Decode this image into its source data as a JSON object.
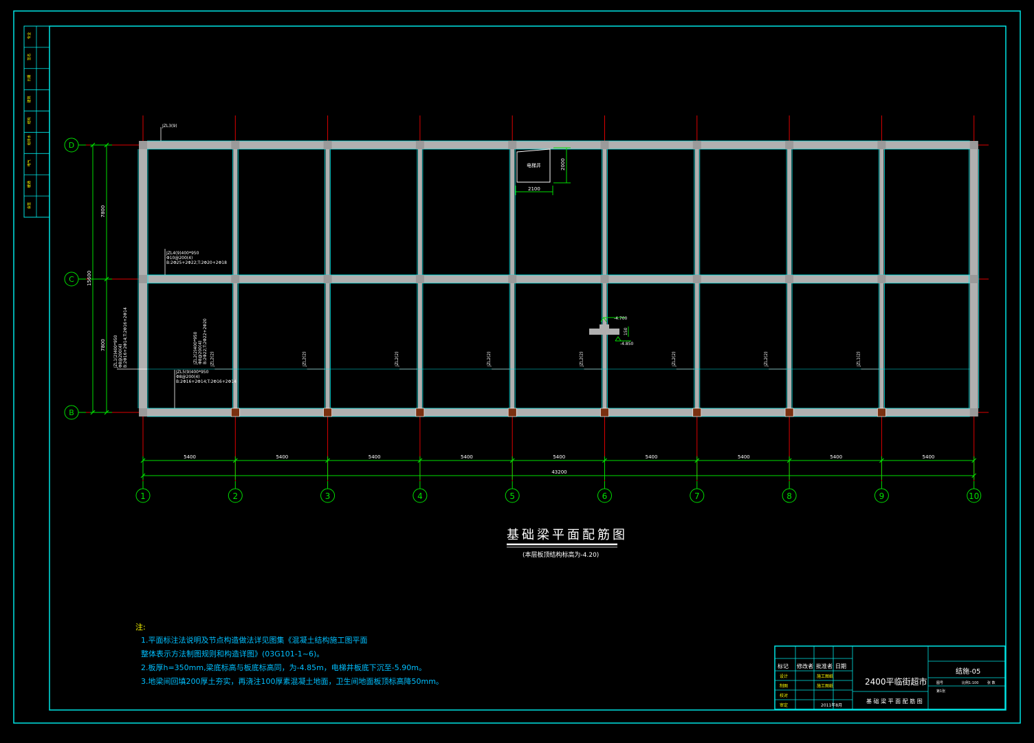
{
  "drawing": {
    "title": "基础梁平面配筋图",
    "subtitle": "(本层板顶结构标高为-4.20)",
    "colors": {
      "background": "#000000",
      "frame": "#00e5e5",
      "axis": "#e00000",
      "dim": "#00e000",
      "beam": "#b0b0b0",
      "text_white": "#ffffff",
      "text_yellow": "#ffff00",
      "note": "#00bfff",
      "beam_edge": "#00e5e5"
    }
  },
  "axes": {
    "columns": [
      "1",
      "2",
      "3",
      "4",
      "5",
      "6",
      "7",
      "8",
      "9",
      "10"
    ],
    "rows": [
      "D",
      "C",
      "B"
    ]
  },
  "dimensions": {
    "bays": [
      "5400",
      "5400",
      "5400",
      "5400",
      "5400",
      "5400",
      "5400",
      "5400",
      "5400"
    ],
    "total": "43200",
    "row_spans": [
      "7800",
      "7800"
    ],
    "row_total": "15600",
    "elevator": {
      "label": "电梯井",
      "width": "2100",
      "height": "2000"
    },
    "pit": {
      "top": "-4.700",
      "bottom": "-4.850",
      "depth": "150"
    }
  },
  "beam_labels": {
    "top": "JZL3(9)",
    "jzl4": [
      "JZL4(9)400*950",
      "Φ10@200(4)",
      "B:2Φ25+2Φ22;T:2Φ20+2Φ18"
    ],
    "jzl1": [
      "JZL1(2)400*950",
      "Φ8@200(4)",
      "B:2Φ16+2Φ14;T:2Φ16+2Φ14"
    ],
    "jzl2": [
      "JZL2(2)400*950",
      "Φ8@200(4)",
      "B:2Φ22;T:2Φ22+2Φ20"
    ],
    "jzl5": [
      "JZL5(9)400*950",
      "Φ8@200(4)",
      "B:2Φ16+2Φ14;T:2Φ16+2Φ14"
    ],
    "vertical": [
      "JZL2(2)",
      "JZL2(2)",
      "JZL2(2)",
      "JZL2(2)",
      "JZL2(2)",
      "JZL2(2)",
      "JZL2(2)",
      "JZL1(2)"
    ]
  },
  "notes": {
    "heading": "注:",
    "lines": [
      "1.平面标注法说明及节点构造做法详见图集《混凝土结构施工图平面",
      "   整体表示方法制图规则和构造详图》(03G101-1~6)。",
      "2.板厚h=350mm,梁底标高与板底标高同，为-4.85m，电梯井板底下沉至-5.90m。",
      "3.地梁间回填200厚土夯实，再浇注100厚素混凝土地面，卫生间地面板顶标高降50mm。"
    ]
  },
  "title_block": {
    "left_headers": [
      "标记",
      "修改者",
      "批准者",
      "日期"
    ],
    "roles": [
      "设计",
      "制图",
      "校对",
      "审定"
    ],
    "names": [
      "",
      "施工图纸",
      "施工图纸",
      "",
      ""
    ],
    "date": "2011年8月",
    "project": "2400平临街超市",
    "drawing_no": "结施-05",
    "small": [
      "图号",
      "比例1:100",
      "张 数",
      "第1张"
    ],
    "sheet_title": "基 础 梁 平 面 配 筋 图"
  },
  "side_block": {
    "rows": [
      "专业",
      "签名",
      "日期",
      "建筑",
      "结构",
      "给排水",
      "电气",
      "暖通",
      "会签"
    ]
  }
}
